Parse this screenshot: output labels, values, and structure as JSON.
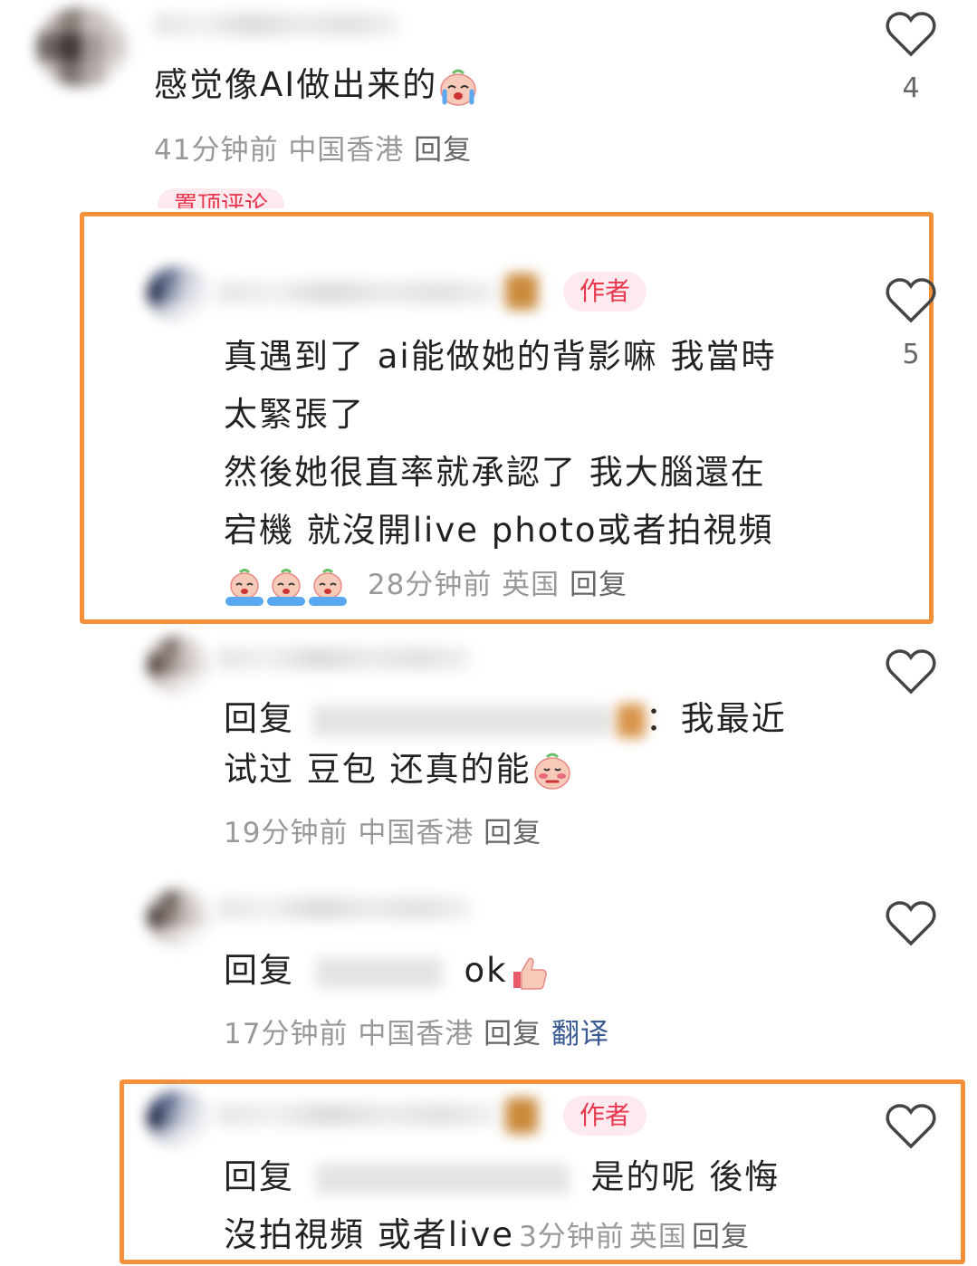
{
  "comments": [
    {
      "text": "感觉像AI做出来的",
      "time": "41分钟前",
      "location": "中国香港",
      "reply": "回复",
      "likes": "4",
      "tag": "置顶评论"
    },
    {
      "author_badge": "作者",
      "lines": [
        "真遇到了 ai能做她的背影嘛 我當時",
        "太緊張了",
        "然後她很直率就承認了 我大腦還在",
        "宕機  就沒開live photo或者拍視頻"
      ],
      "time": "28分钟前",
      "location": "英国",
      "reply": "回复",
      "likes": "5"
    },
    {
      "reply_prefix": "回复",
      "line1_suffix": "：我最近",
      "line2": "试过 豆包 还真的能",
      "time": "19分钟前",
      "location": "中国香港",
      "reply": "回复"
    },
    {
      "reply_prefix": "回复",
      "text": "ok",
      "time": "17分钟前",
      "location": "中国香港",
      "reply": "回复",
      "translate": "翻译"
    },
    {
      "author_badge": "作者",
      "reply_prefix": "回复",
      "line1_suffix": "是的呢 後悔",
      "line2": "沒拍視頻 或者live",
      "time": "3分钟前",
      "location": "英国",
      "reply": "回复"
    }
  ],
  "icons": {
    "like": "heart-outline-icon",
    "emoji_cry": "crying-face-emoji",
    "emoji_shy": "shy-face-emoji",
    "emoji_thumb": "thumbs-up-emoji"
  },
  "colors": {
    "highlight_frame": "#f4903a",
    "author_badge": "#e8384f",
    "translate_link": "#3a5a93"
  }
}
